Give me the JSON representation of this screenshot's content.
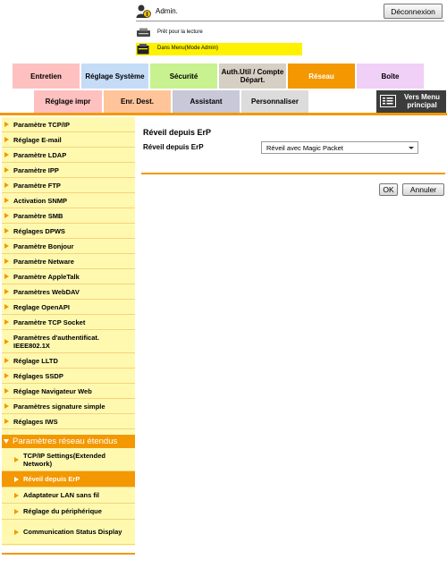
{
  "header": {
    "user_name": "Admin.",
    "logout_label": "Déconnexion",
    "status_text": "Prêt pour la lecture",
    "mode_text": "Dans Menu(Mode Admin)"
  },
  "tabs_row1": [
    {
      "label": "Entretien",
      "color": "#ffc0c0"
    },
    {
      "label": "Réglage Système",
      "color": "#c5dcf7"
    },
    {
      "label": "Sécurité",
      "color": "#c8f28f"
    },
    {
      "label": "Auth.Util / Compte Départ.",
      "color": "#d6cfc4"
    },
    {
      "label": "Réseau",
      "color": "#f39800"
    },
    {
      "label": "Boîte",
      "color": "#f0d0f7"
    }
  ],
  "tabs_row2": [
    {
      "label": "Réglage impr",
      "color": "#ffc0c0"
    },
    {
      "label": "Enr. Dest.",
      "color": "#ffc49a"
    },
    {
      "label": "Assistant",
      "color": "#c8c8d8"
    },
    {
      "label": "Personnaliser",
      "color": "#dcdcdc"
    }
  ],
  "vers_menu_label": "Vers Menu principal",
  "sidebar": {
    "items": [
      "Paramètre TCP/IP",
      "Réglage E-mail",
      "Paramètre LDAP",
      "Paramètre IPP",
      "Paramètre FTP",
      "Activation SNMP",
      "Paramètre SMB",
      "Réglages DPWS",
      "Paramètre Bonjour",
      "Paramètre Netware",
      "Paramètre AppleTalk",
      "Paramètres WebDAV",
      "Reglage OpenAPI",
      "Paramètre TCP Socket",
      "Paramètres d'authentificat. IEEE802.1X",
      "Réglage LLTD",
      "Réglages SSDP",
      "Réglage Navigateur Web",
      "Paramètres signature simple",
      "Réglages IWS"
    ],
    "section_title": "Paramètres réseau étendus",
    "sub_items": [
      "TCP/IP Settings(Extended Network)",
      "Réveil depuis ErP",
      "Adaptateur LAN sans fil",
      "Réglage du périphérique",
      "Communication Status Display"
    ],
    "active_sub_item": "Réveil depuis ErP"
  },
  "main": {
    "title": "Réveil depuis ErP",
    "field_label": "Réveil depuis ErP",
    "select_value": "Réveil avec Magic Packet",
    "ok_label": "OK",
    "cancel_label": "Annuler"
  },
  "colors": {
    "accent": "#f39800",
    "sidebar_bg": "#fff9b0",
    "mode_bar": "#fff200"
  }
}
